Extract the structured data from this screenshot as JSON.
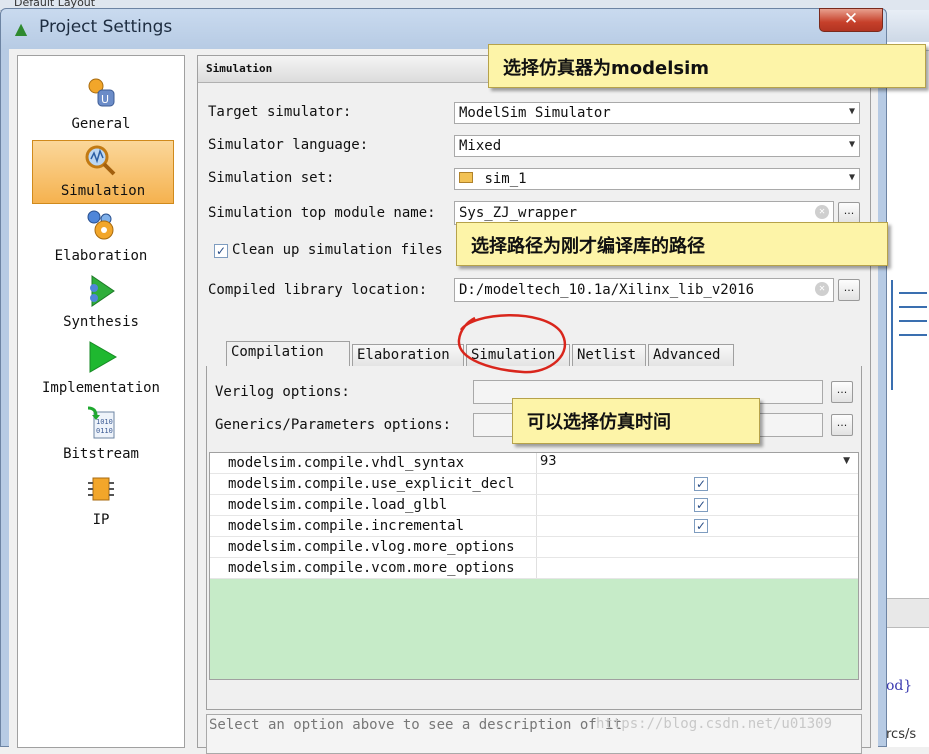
{
  "window": {
    "title": "Project Settings",
    "background_tab_text": "Default Layout",
    "close_glyph": "✕"
  },
  "nav": {
    "items": [
      {
        "label": "General",
        "icon": "general-icon"
      },
      {
        "label": "Simulation",
        "icon": "simulation-icon",
        "selected": true
      },
      {
        "label": "Elaboration",
        "icon": "elaboration-icon"
      },
      {
        "label": "Synthesis",
        "icon": "synthesis-icon"
      },
      {
        "label": "Implementation",
        "icon": "implementation-icon"
      },
      {
        "label": "Bitstream",
        "icon": "bitstream-icon"
      },
      {
        "label": "IP",
        "icon": "ip-icon"
      }
    ]
  },
  "panel": {
    "header": "Simulation",
    "target_simulator": {
      "label": "Target simulator:",
      "value": "ModelSim Simulator"
    },
    "simulator_language": {
      "label": "Simulator language:",
      "value": "Mixed"
    },
    "simulation_set": {
      "label": "Simulation set:",
      "value": "sim_1"
    },
    "top_module": {
      "label": "Simulation top module name:",
      "value": "Sys_ZJ_wrapper"
    },
    "cleanup": {
      "label": "Clean up simulation files",
      "checked": true
    },
    "compiled_lib": {
      "label": "Compiled library location:",
      "value": "D:/modeltech_10.1a/Xilinx_lib_v2016"
    },
    "browse_label": "...",
    "tabs": [
      {
        "label": "Compilation",
        "active": true
      },
      {
        "label": "Elaboration"
      },
      {
        "label": "Simulation"
      },
      {
        "label": "Netlist"
      },
      {
        "label": "Advanced"
      }
    ],
    "verilog_options_label": "Verilog options:",
    "generics_label": "Generics/Parameters options:",
    "options_table": [
      {
        "key": "modelsim.compile.vhdl_syntax",
        "value": "93",
        "dropdown": true
      },
      {
        "key": "modelsim.compile.use_explicit_decl",
        "checked": true
      },
      {
        "key": "modelsim.compile.load_glbl",
        "checked": true
      },
      {
        "key": "modelsim.compile.incremental",
        "checked": true
      },
      {
        "key": "modelsim.compile.vlog.more_options",
        "value": ""
      },
      {
        "key": "modelsim.compile.vcom.more_options",
        "value": ""
      }
    ],
    "description_placeholder": "Select an option above to see a description of it"
  },
  "annotations": {
    "callout1": "选择仿真器为modelsim",
    "callout2": "选择路径为刚才编译库的路径",
    "callout3": "可以选择仿真时间"
  },
  "background": {
    "right_text_1": "od}",
    "right_text_2": "rcs/s"
  },
  "watermark": "https://blog.csdn.net/u01309",
  "colors": {
    "nav_selected": "#f5b24f",
    "callout_bg": "#fdf4a8",
    "annotation_circle": "#d9261c",
    "table_empty_area": "#c6ebc8"
  }
}
